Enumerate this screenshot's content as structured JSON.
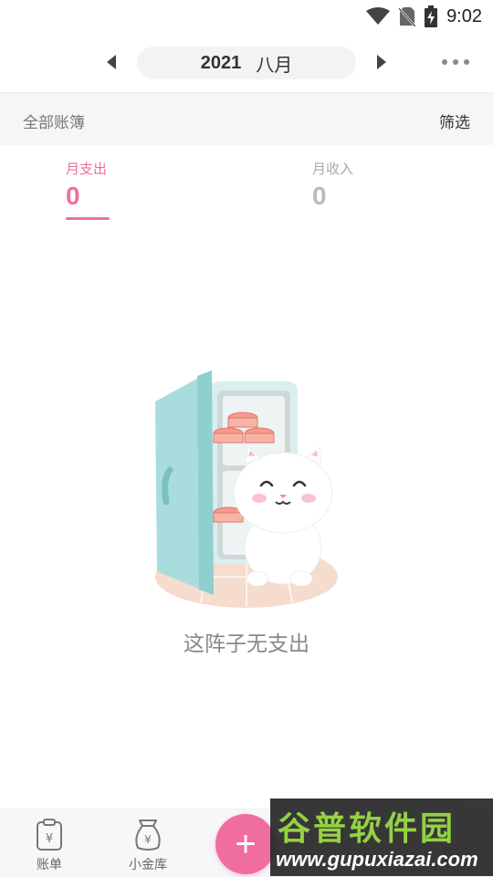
{
  "status_bar": {
    "time": "9:02"
  },
  "header": {
    "year": "2021",
    "month": "八月"
  },
  "filter": {
    "ledger_label": "全部账簿",
    "filter_label": "筛选"
  },
  "summary": {
    "expense": {
      "label": "月支出",
      "value": "0"
    },
    "income": {
      "label": "月收入",
      "value": "0"
    }
  },
  "empty_state": {
    "message": "这阵子无支出"
  },
  "bottom_nav": {
    "items": [
      {
        "label": "账单",
        "icon": "clipboard-yen-icon"
      },
      {
        "label": "小金库",
        "icon": "money-bag-yen-icon"
      }
    ],
    "add_button": {
      "icon": "plus-icon"
    }
  },
  "watermark": {
    "title": "谷普软件园",
    "url": "www.gupuxiazai.com"
  },
  "colors": {
    "accent": "#f06da0",
    "fridge": "#bfe6e4",
    "filter_bg": "#f6f6f8"
  }
}
